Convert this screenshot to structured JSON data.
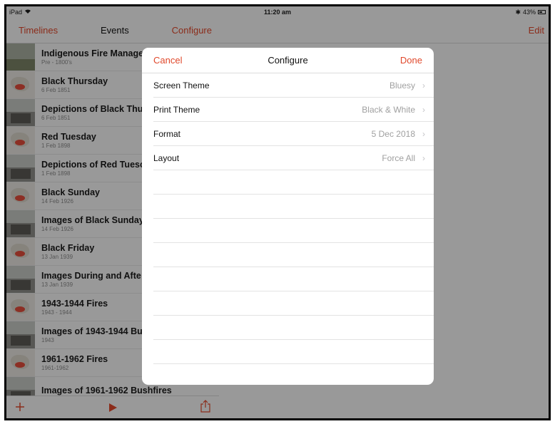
{
  "status_bar": {
    "device": "iPad",
    "time": "11:20 am",
    "battery": "43%"
  },
  "sidebar": {
    "nav": {
      "left_label": "Timelines",
      "title": "Events",
      "right_label": "Configure"
    },
    "events": [
      {
        "name": "Indigenous Fire Manage",
        "date": "Pre - 1800's",
        "thumb": "landscape"
      },
      {
        "name": "Black Thursday",
        "date": "6 Feb 1851",
        "thumb": "map"
      },
      {
        "name": "Depictions of Black Thu",
        "date": "6 Feb 1851",
        "thumb": "photo"
      },
      {
        "name": "Red Tuesday",
        "date": "1 Feb 1898",
        "thumb": "map"
      },
      {
        "name": "Depictions of Red Tuesc",
        "date": "1 Feb 1898",
        "thumb": "photo"
      },
      {
        "name": "Black Sunday",
        "date": "14 Feb 1926",
        "thumb": "map"
      },
      {
        "name": "Images of Black Sunday",
        "date": "14 Feb 1926",
        "thumb": "photo"
      },
      {
        "name": "Black Friday",
        "date": "13 Jan 1939",
        "thumb": "map"
      },
      {
        "name": "Images During and Afte",
        "date": "13 Jan 1939",
        "thumb": "photo"
      },
      {
        "name": "1943-1944 Fires",
        "date": "1943 - 1944",
        "thumb": "map"
      },
      {
        "name": "Images of 1943-1944 Bu",
        "date": "1943",
        "thumb": "photo"
      },
      {
        "name": "1961-1962 Fires",
        "date": "1961-1962",
        "thumb": "map"
      },
      {
        "name": "Images of 1961-1962 Bushfires",
        "date": "",
        "thumb": "photo"
      }
    ],
    "toolbar": {
      "add_icon": "plus-icon",
      "play_icon": "play-icon",
      "share_icon": "share-icon"
    }
  },
  "detail": {
    "edit_label": "Edit"
  },
  "modal": {
    "cancel_label": "Cancel",
    "title": "Configure",
    "done_label": "Done",
    "settings": [
      {
        "label": "Screen Theme",
        "value": "Bluesy"
      },
      {
        "label": "Print Theme",
        "value": "Black & White"
      },
      {
        "label": "Format",
        "value": "5 Dec 2018"
      },
      {
        "label": "Layout",
        "value": "Force All"
      }
    ]
  },
  "colors": {
    "accent": "#e0482b",
    "overlay": "rgba(0,0,0,0.38)"
  }
}
